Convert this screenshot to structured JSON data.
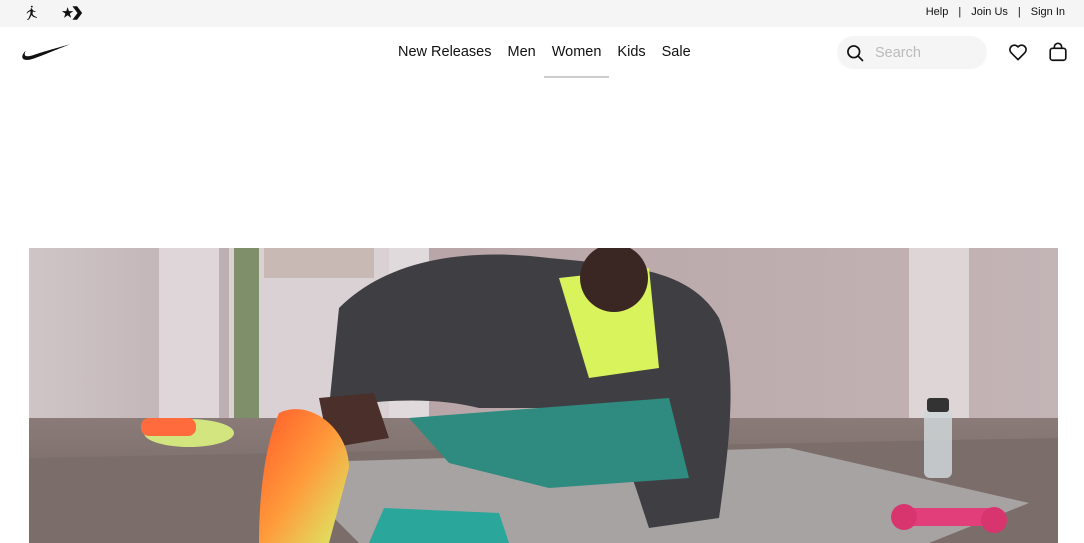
{
  "utility_bar": {
    "brands": [
      {
        "name": "Jordan",
        "icon": "jumpman-icon"
      },
      {
        "name": "Converse",
        "icon": "converse-star-chevron-icon"
      }
    ],
    "links": [
      {
        "label": "Help"
      },
      {
        "label": "Join Us"
      },
      {
        "label": "Sign In"
      }
    ],
    "separator": "|"
  },
  "header": {
    "logo_icon": "nike-swoosh-icon",
    "nav": [
      {
        "label": "New Releases",
        "active": false
      },
      {
        "label": "Men",
        "active": false
      },
      {
        "label": "Women",
        "active": true
      },
      {
        "label": "Kids",
        "active": false
      },
      {
        "label": "Sale",
        "active": false
      }
    ],
    "search": {
      "placeholder": "Search",
      "value": "",
      "icon": "search-icon"
    },
    "favorites_icon": "heart-icon",
    "bag_icon": "shopping-bag-icon"
  },
  "colors": {
    "utility_bg": "#f5f5f5",
    "text": "#111111",
    "search_bg": "#f5f5f5",
    "placeholder": "#bbbbbb",
    "active_underline": "#cccccc"
  },
  "hero": {
    "image": "hero-photo"
  }
}
